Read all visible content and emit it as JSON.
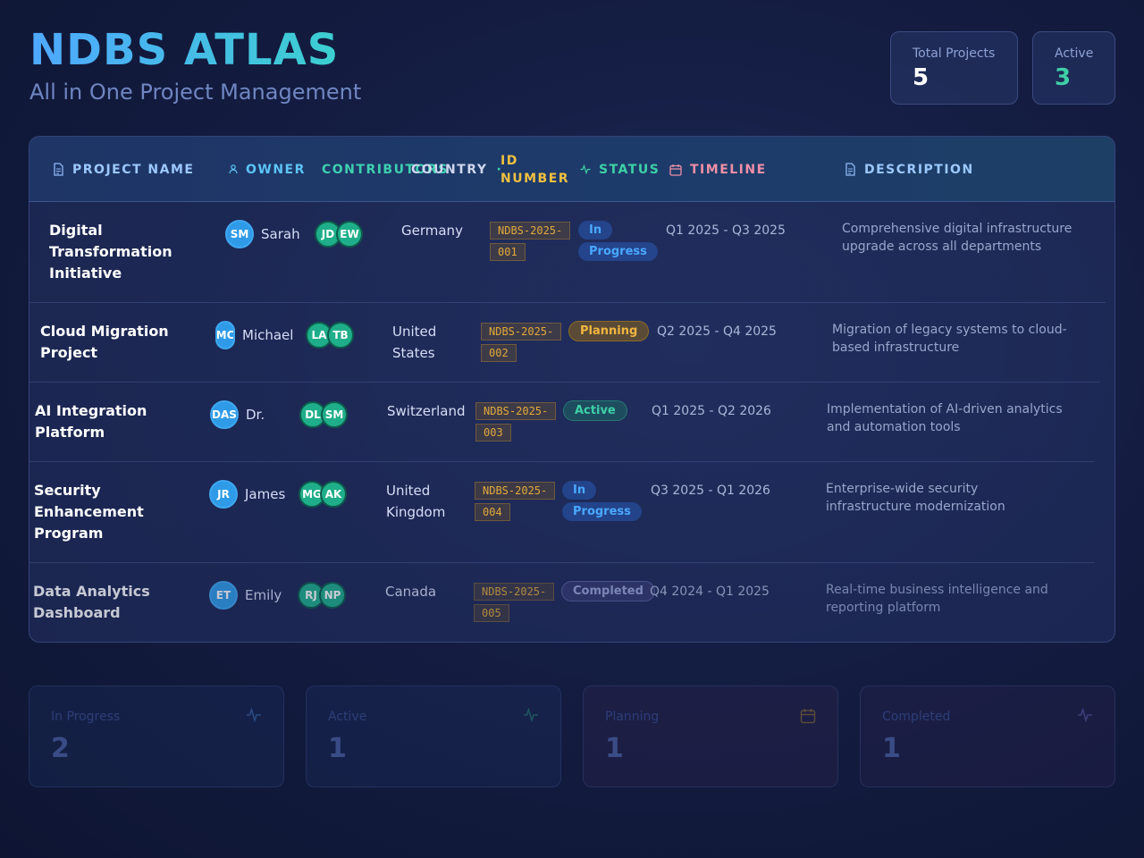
{
  "header": {
    "title": "NDBS ATLAS",
    "subtitle": "All in One Project Management"
  },
  "stats": {
    "total_label": "Total Projects",
    "total_value": "5",
    "active_label": "Active",
    "active_value": "3"
  },
  "table": {
    "columns": {
      "name": "PROJECT NAME",
      "owner": "OWNER",
      "contributors": "CONTRIBUTORS",
      "country": "COUNTRY",
      "id": "ID NUMBER",
      "status": "STATUS",
      "timeline": "TIMELINE",
      "description": "DESCRIPTION"
    },
    "rows": [
      {
        "name": "Digital Transformation Initiative",
        "owner_initials": "SM",
        "owner_name": "Sarah",
        "contributors": [
          "JD",
          "EW"
        ],
        "country": "Germany",
        "id": "NDBS-2025-001",
        "status": "In Progress",
        "timeline": "Q1 2025 - Q3 2025",
        "description": "Comprehensive digital infrastructure upgrade across all departments"
      },
      {
        "name": "Cloud Migration Project",
        "owner_initials": "MC",
        "owner_name": "Michael",
        "contributors": [
          "LA",
          "TB"
        ],
        "country": "United States",
        "id": "NDBS-2025-002",
        "status": "Planning",
        "timeline": "Q2 2025 - Q4 2025",
        "description": "Migration of legacy systems to cloud-based infrastructure"
      },
      {
        "name": "AI Integration Platform",
        "owner_initials": "DAS",
        "owner_name": "Dr.",
        "contributors": [
          "DL",
          "SM"
        ],
        "country": "Switzerland",
        "id": "NDBS-2025-003",
        "status": "Active",
        "timeline": "Q1 2025 - Q2 2026",
        "description": "Implementation of AI-driven analytics and automation tools"
      },
      {
        "name": "Security Enhancement Program",
        "owner_initials": "JR",
        "owner_name": "James",
        "contributors": [
          "MG",
          "AK"
        ],
        "country": "United Kingdom",
        "id": "NDBS-2025-004",
        "status": "In Progress",
        "timeline": "Q3 2025 - Q1 2026",
        "description": "Enterprise-wide security infrastructure modernization"
      },
      {
        "name": "Data Analytics Dashboard",
        "owner_initials": "ET",
        "owner_name": "Emily",
        "contributors": [
          "RJ",
          "NP"
        ],
        "country": "Canada",
        "id": "NDBS-2025-005",
        "status": "Completed",
        "timeline": "Q4 2024 - Q1 2025",
        "description": "Real-time business intelligence and reporting platform"
      }
    ]
  },
  "summary": [
    {
      "label": "In Progress",
      "value": "2",
      "icon": "activity-icon"
    },
    {
      "label": "Active",
      "value": "1",
      "icon": "activity-icon"
    },
    {
      "label": "Planning",
      "value": "1",
      "icon": "calendar-icon"
    },
    {
      "label": "Completed",
      "value": "1",
      "icon": "activity-icon"
    }
  ],
  "colors": {
    "accent_blue": "#4fa8ff",
    "accent_teal": "#3ed0a6",
    "id_gold": "#e0a93a",
    "timeline_pink": "#f08fa8"
  }
}
